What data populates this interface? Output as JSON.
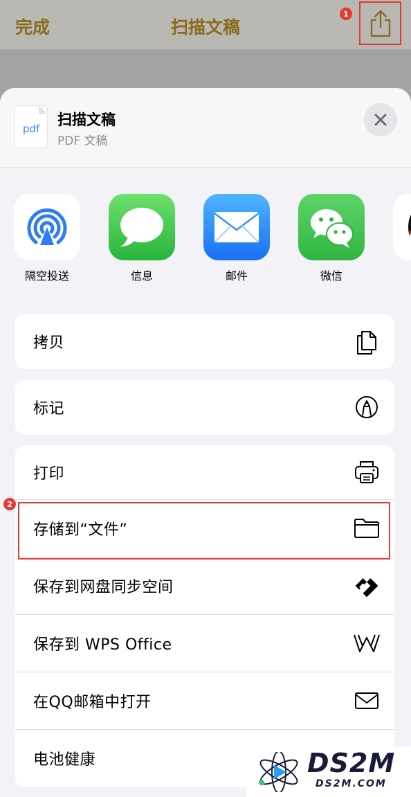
{
  "navbar": {
    "done": "完成",
    "title": "扫描文稿",
    "share_badge": "1"
  },
  "sheet": {
    "doc_icon_text": "pdf",
    "title": "扫描文稿",
    "subtitle": "PDF 文稿"
  },
  "apps": [
    {
      "label": "隔空投送",
      "icon": "airdrop-icon"
    },
    {
      "label": "信息",
      "icon": "messages-icon"
    },
    {
      "label": "邮件",
      "icon": "mail-icon"
    },
    {
      "label": "微信",
      "icon": "wechat-icon"
    },
    {
      "label": "",
      "icon": "qq-icon"
    }
  ],
  "actions": {
    "copy": "拷贝",
    "markup": "标记",
    "print": "打印",
    "save_to_files": "存储到“文件”",
    "save_to_netdisk": "保存到网盘同步空间",
    "save_to_wps": "保存到 WPS Office",
    "open_in_qq_mail": "在QQ邮箱中打开",
    "battery_health": "电池健康"
  },
  "step_badge_2": "2",
  "watermark": {
    "main": "DS2M",
    "sub": "DS2M.COM"
  },
  "colors": {
    "accent_gold": "#8a6b1d",
    "annotation_red": "#e53935"
  }
}
